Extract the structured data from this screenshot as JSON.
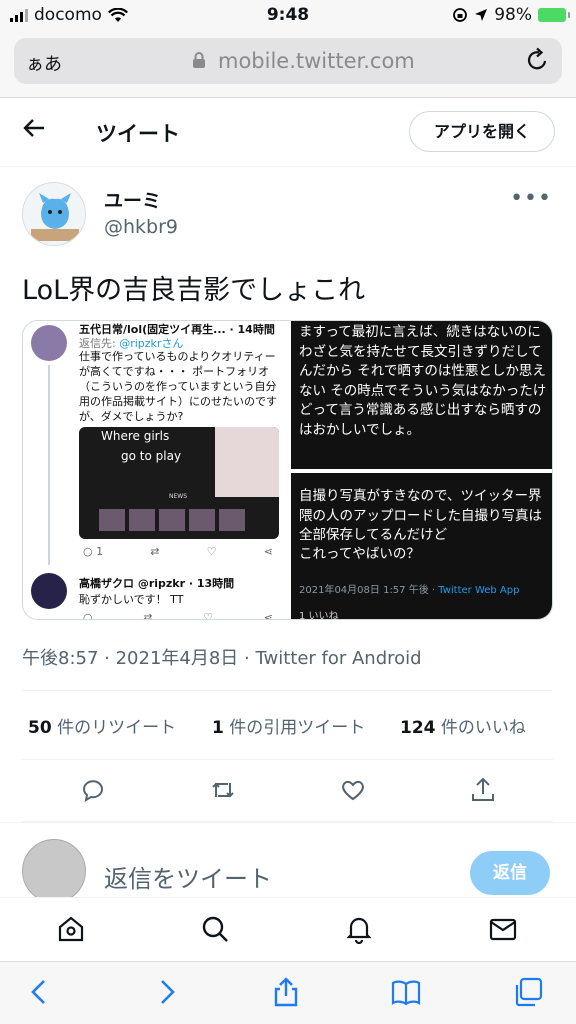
{
  "status_bar": {
    "carrier": "docomo",
    "time": "9:48",
    "battery": "98%"
  },
  "browser": {
    "text_size_button": "ぁあ",
    "url": "mobile.twitter.com"
  },
  "header": {
    "title": "ツイート",
    "open_app_label": "アプリを開く"
  },
  "tweet": {
    "author_name": "ユーミ",
    "author_handle": "@hkbr9",
    "text": "LoL界の吉良吉影でしょこれ",
    "timestamp": "午後8:57 · 2021年4月8日 · Twitter for Android"
  },
  "media": {
    "left": {
      "name": "五代日常/lol(固定ツイ再生... · 14時間",
      "reply_to_prefix": "返信先: ",
      "reply_to_handle": "@ripzkrさん",
      "body": "仕事で作っているものよりクオリティーが高くてですね・・・ ポートフォリオ（こういうのを作っていますという自分用の作品掲載サイト）にのせたいのですが、ダメでしょうか?",
      "image_title_1": "Where girls",
      "image_title_2": "go to play",
      "image_caption": "NEWS",
      "reply_count": "1",
      "second_name": "高橋ザクロ @ripzkr · 13時間",
      "second_body": "恥ずかしいです！ TT"
    },
    "right_top": "ますって最初に言えば、続きはないのに わざと気を持たせて長文引きずりだしてんだから それで晒すのは性悪としか思えない その時点でそういう気はなかったけどって言う常識ある感じ出すなら晒すのはおかしいでしょ。",
    "right_bottom_body": "自撮り写真がすきなので、ツイッター界隈の人のアップロードした自撮り写真は全部保存してるんだけど",
    "right_bottom_question": "これってやばいの？",
    "right_bottom_meta": "2021年04月08日 1:57 午後 · ",
    "right_bottom_via": "Twitter Web App",
    "right_bottom_likes": "1 いいね"
  },
  "stats": {
    "retweets_count": "50",
    "retweets_label": " 件のリツイート",
    "quotes_count": "1",
    "quotes_label": " 件の引用ツイート",
    "likes_count": "124",
    "likes_label": " 件のいいね"
  },
  "reply": {
    "placeholder": "返信をツイート",
    "button_label": "返信"
  },
  "colors": {
    "accent": "#1d9bf0",
    "reply_button": "#8ecdf8",
    "muted_text": "#536471"
  }
}
